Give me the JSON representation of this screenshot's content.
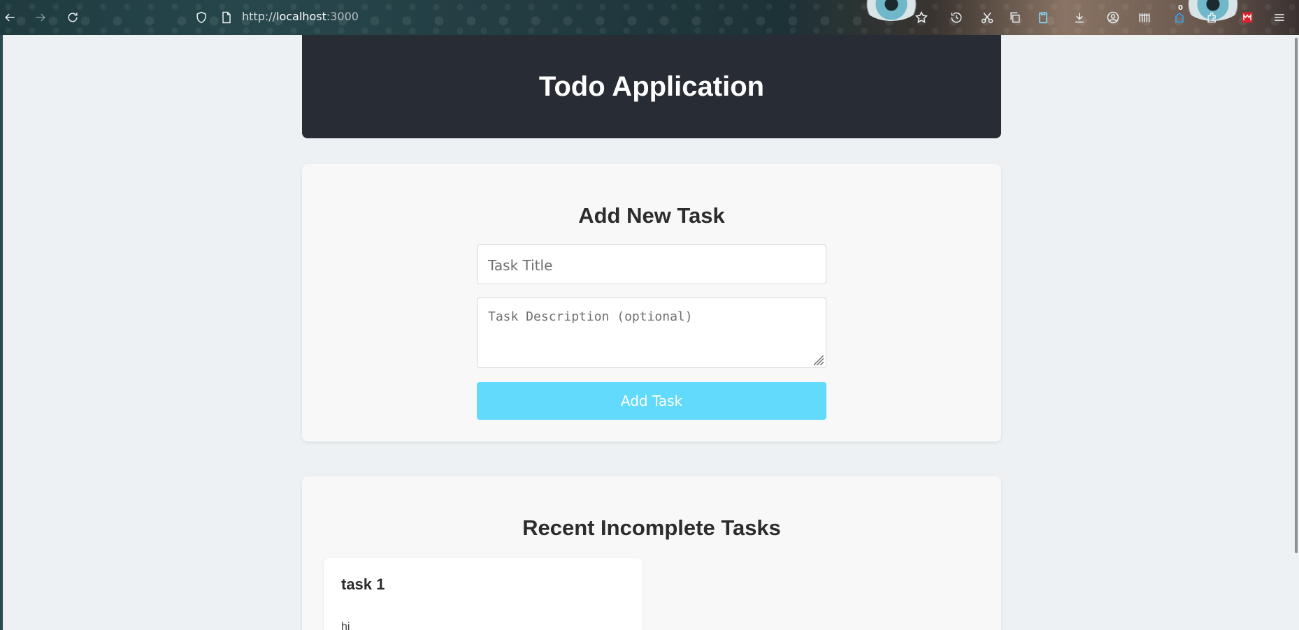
{
  "browser": {
    "url_scheme": "http://",
    "url_host": "localhost",
    "url_port": ":3000",
    "extension_badge_count": "0",
    "icons": [
      "back-icon",
      "forward-icon",
      "reload-icon",
      "shield-icon",
      "page-icon",
      "bookmark-star-icon",
      "history-icon",
      "scissors-icon",
      "copy-icon",
      "clipboard-icon",
      "download-icon",
      "account-icon",
      "library-icon",
      "extension-icon",
      "puzzle-icon",
      "mega-icon",
      "menu-icon"
    ]
  },
  "header": {
    "title": "Todo Application"
  },
  "add_form": {
    "heading": "Add New Task",
    "title_placeholder": "Task Title",
    "description_placeholder": "Task Description (optional)",
    "submit_label": "Add Task"
  },
  "task_list": {
    "heading": "Recent Incomplete Tasks",
    "tasks": [
      {
        "title": "task 1",
        "description": "hi"
      }
    ]
  },
  "colors": {
    "header_bg": "#282c34",
    "accent_button": "#61dafb",
    "page_bg": "#edf1f4",
    "card_bg": "#f8f8f8"
  }
}
